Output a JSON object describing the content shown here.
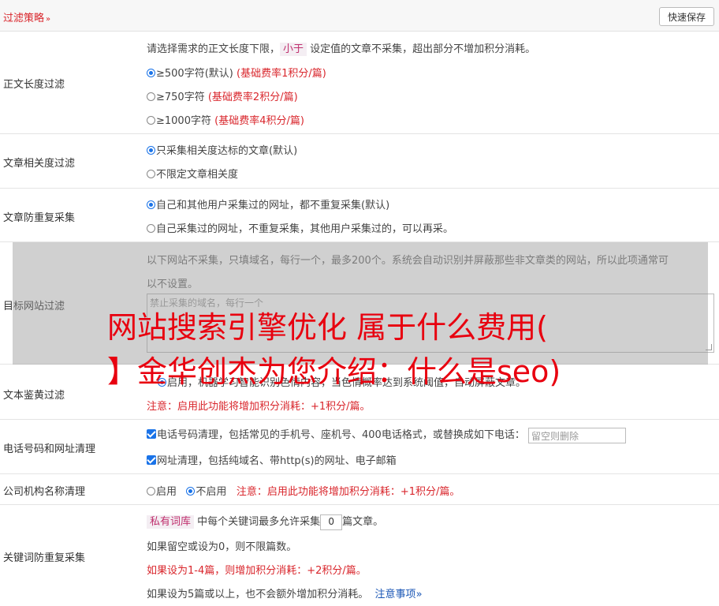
{
  "header": {
    "title": "过滤策略",
    "chevron": "»",
    "save_label": "快速保存"
  },
  "length_filter": {
    "label": "正文长度过滤",
    "desc_before": "请选择需求的正文长度下限，",
    "chip": "小于",
    "desc_after": "设定值的文章不采集，超出部分不增加积分消耗。",
    "options": [
      {
        "text": "≥500字符(默认)",
        "note": "(基础费率1积分/篇)",
        "checked": true
      },
      {
        "text": "≥750字符",
        "note": "(基础费率2积分/篇)",
        "checked": false
      },
      {
        "text": "≥1000字符",
        "note": "(基础费率4积分/篇)",
        "checked": false
      }
    ]
  },
  "relevance": {
    "label": "文章相关度过滤",
    "options": [
      {
        "text": "只采集相关度达标的文章(默认)",
        "checked": true
      },
      {
        "text": "不限定文章相关度",
        "checked": false
      }
    ]
  },
  "dedupe": {
    "label": "文章防重复采集",
    "options": [
      {
        "text": "自己和其他用户采集过的网址，都不重复采集(默认)",
        "checked": true
      },
      {
        "text": "自己采集过的网址，不重复采集，其他用户采集过的，可以再采。",
        "checked": false
      }
    ]
  },
  "site_filter": {
    "label": "目标网站过滤",
    "desc_line1": "以下网站不采集，只填域名，每行一个，最多200个。系统会自动识别并屏蔽那些非文章类的网站，所以此项通常可",
    "desc_line2": "以不设置。",
    "placeholder": "禁止采集的域名，每行一个"
  },
  "porn_filter": {
    "label": "文本鉴黄过滤",
    "option_text": "启用，机器学习智能识别色情内容，当色情概率达到系统阈值，自动屏蔽文章。",
    "note": "注意：启用此功能将增加积分消耗：+1积分/篇。"
  },
  "phone_cleanup": {
    "label": "电话号码和网址清理",
    "phone_text": "电话号码清理，包括常见的手机号、座机号、400电话格式，或替换成如下电话：",
    "phone_placeholder": "留空则删除",
    "url_text": "网址清理，包括纯域名、带http(s)的网址、电子邮箱"
  },
  "org_cleanup": {
    "label": "公司机构名称清理",
    "enable": "启用",
    "disable": "不启用",
    "note": "注意：启用此功能将增加积分消耗：+1积分/篇。"
  },
  "keyword_dedupe": {
    "label": "关键词防重复采集",
    "chip": "私有词库",
    "line1_mid": "中每个关键词最多允许采集",
    "count_value": "0",
    "line1_end": "篇文章。",
    "line2": "如果留空或设为0，则不限篇数。",
    "line3": "如果设为1-4篇，则增加积分消耗：+2积分/篇。",
    "line4": "如果设为5篇或以上，也不会额外增加积分消耗。",
    "notes_link": "注意事项",
    "notes_chevron": "»"
  },
  "watermark": {
    "line1": "网站搜索引擎优化 属于什么费用(",
    "line2": "】金华创杰为您介绍：什么是seo)"
  },
  "colors": {
    "accent": "#d9262c",
    "primary": "#1a73e8"
  }
}
